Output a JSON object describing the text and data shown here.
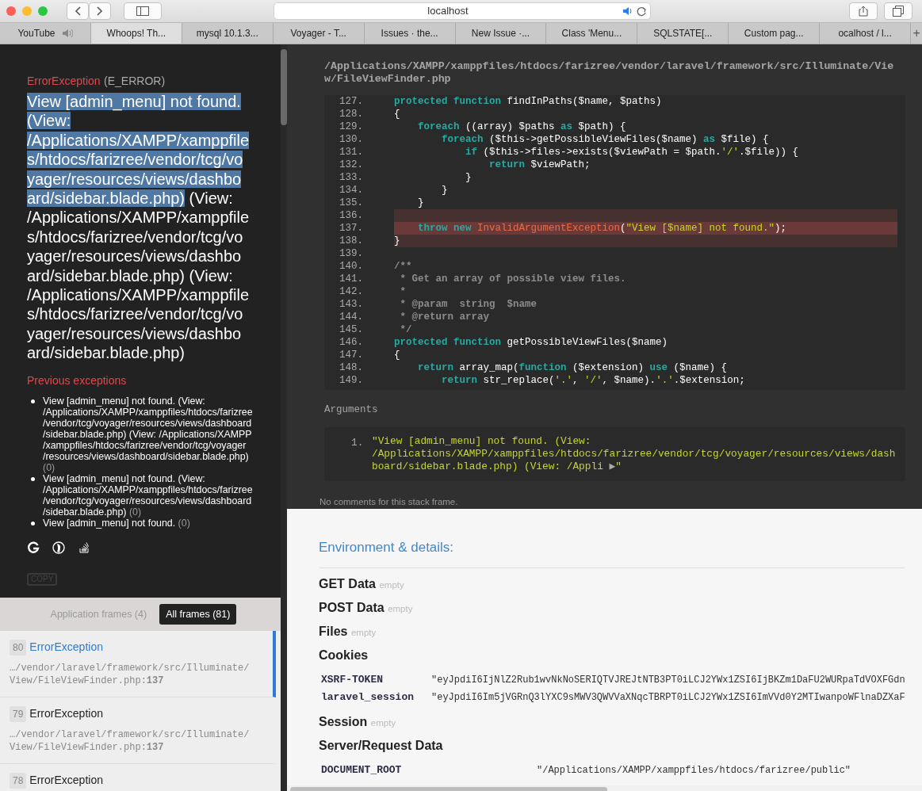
{
  "browser": {
    "url": "localhost",
    "new_tab": "+",
    "tabs": [
      {
        "label": "YouTube",
        "audio": true,
        "selected": false
      },
      {
        "label": "Whoops! Th...",
        "audio": false,
        "selected": true
      },
      {
        "label": "mysql 10.1.3...",
        "audio": false,
        "selected": false
      },
      {
        "label": "Voyager - T...",
        "audio": false,
        "selected": false
      },
      {
        "label": "Issues · the...",
        "audio": false,
        "selected": false
      },
      {
        "label": "New Issue ·...",
        "audio": false,
        "selected": false
      },
      {
        "label": "Class 'Menu...",
        "audio": false,
        "selected": false
      },
      {
        "label": "SQLSTATE[...",
        "audio": false,
        "selected": false
      },
      {
        "label": "Custom pag...",
        "audio": false,
        "selected": false
      },
      {
        "label": "ocalhost / l...",
        "audio": false,
        "selected": false
      }
    ]
  },
  "exception": {
    "type": "ErrorException",
    "code": "(E_ERROR)",
    "message_parts": [
      {
        "text": "View [admin_menu] not found. (View: /Applications/XAMPP/xamppfiles/htdocs/farizree/vendor/tcg/voyager/resources/views/dashboard/sidebar.blade.php)",
        "selected": true
      },
      {
        "text": " (View: /Applications/XAMPP/xamppfiles/htdocs/farizree/vendor/tcg/voyager/resources/views/dashboard/sidebar.blade.php) (View: /Applications/XAMPP/xamppfiles/htdocs/farizree/vendor/tcg/voyager/resources/views/dashboard/sidebar.blade.php)",
        "selected": false
      }
    ],
    "previous_title": "Previous exceptions",
    "previous": [
      {
        "text": "View [admin_menu] not found. (View: /Applications/XAMPP/xamppfiles/htdocs/farizree/vendor/tcg/voyager/resources/views/dashboard/sidebar.blade.php) (View: /Applications/XAMPP/xamppfiles/htdocs/farizree/vendor/tcg/voyager/resources/views/dashboard/sidebar.blade.php)",
        "code": "(0)"
      },
      {
        "text": "View [admin_menu] not found. (View: /Applications/XAMPP/xamppfiles/htdocs/farizree/vendor/tcg/voyager/resources/views/dashboard/sidebar.blade.php)",
        "code": "(0)"
      },
      {
        "text": "View [admin_menu] not found.",
        "code": "(0)"
      }
    ],
    "copy_button": "COPY"
  },
  "frame_tabs": [
    {
      "label": "Application frames (4)",
      "selected": false
    },
    {
      "label": "All frames (81)",
      "selected": true
    }
  ],
  "frames": [
    {
      "number": "80",
      "type": "ErrorException",
      "path": "…/vendor/laravel/framework/src/Illuminate/View/FileViewFinder.php:",
      "line": "137",
      "selected": true
    },
    {
      "number": "79",
      "type": "ErrorException",
      "path": "…/vendor/laravel/framework/src/Illuminate/View/FileViewFinder.php:",
      "line": "137",
      "selected": false
    },
    {
      "number": "78",
      "type": "ErrorException",
      "selected": false
    }
  ],
  "code": {
    "file": "/Applications/XAMPP/xamppfiles/htdocs/farizree/vendor/laravel/framework/src/Illuminate/View/FileViewFinder.php",
    "lines": [
      {
        "number": "127.",
        "highlighted": false,
        "error": false,
        "tokens": [
          {
            "kind": "keyword",
            "text": "protected function"
          },
          {
            "kind": "plain",
            "text": " findInPaths($name, $paths)"
          }
        ]
      },
      {
        "number": "128.",
        "highlighted": false,
        "error": false,
        "tokens": [
          {
            "kind": "plain",
            "text": "{"
          }
        ]
      },
      {
        "number": "129.",
        "highlighted": false,
        "error": false,
        "tokens": [
          {
            "kind": "keyword",
            "text": "    foreach"
          },
          {
            "kind": "plain",
            "text": " ((array) $paths "
          },
          {
            "kind": "keyword",
            "text": "as"
          },
          {
            "kind": "plain",
            "text": " $path) {"
          }
        ]
      },
      {
        "number": "130.",
        "highlighted": false,
        "error": false,
        "tokens": [
          {
            "kind": "keyword",
            "text": "        foreach"
          },
          {
            "kind": "plain",
            "text": " ($this->getPossibleViewFiles($name) "
          },
          {
            "kind": "keyword",
            "text": "as"
          },
          {
            "kind": "plain",
            "text": " $file) {"
          }
        ]
      },
      {
        "number": "131.",
        "highlighted": false,
        "error": false,
        "tokens": [
          {
            "kind": "keyword",
            "text": "            if"
          },
          {
            "kind": "plain",
            "text": " ($this->files->exists($viewPath = $path."
          },
          {
            "kind": "string",
            "text": "'/'"
          },
          {
            "kind": "plain",
            "text": ".$file)) {"
          }
        ]
      },
      {
        "number": "132.",
        "highlighted": false,
        "error": false,
        "tokens": [
          {
            "kind": "keyword",
            "text": "                return"
          },
          {
            "kind": "plain",
            "text": " $viewPath;"
          }
        ]
      },
      {
        "number": "133.",
        "highlighted": false,
        "error": false,
        "tokens": [
          {
            "kind": "plain",
            "text": "            }"
          }
        ]
      },
      {
        "number": "134.",
        "highlighted": false,
        "error": false,
        "tokens": [
          {
            "kind": "plain",
            "text": "        }"
          }
        ]
      },
      {
        "number": "135.",
        "highlighted": false,
        "error": false,
        "tokens": [
          {
            "kind": "plain",
            "text": "    }"
          }
        ]
      },
      {
        "number": "136.",
        "highlighted": true,
        "error": false
      },
      {
        "number": "137.",
        "highlighted": true,
        "error": true,
        "tokens": [
          {
            "kind": "keyword",
            "text": "    throw new "
          },
          {
            "kind": "class",
            "text": "InvalidArgumentException"
          },
          {
            "kind": "plain",
            "text": "("
          },
          {
            "kind": "string",
            "text": "\"View [$name] not found.\""
          },
          {
            "kind": "plain",
            "text": ");"
          }
        ]
      },
      {
        "number": "138.",
        "highlighted": true,
        "error": false,
        "tokens": [
          {
            "kind": "plain",
            "text": "}"
          }
        ]
      },
      {
        "number": "139.",
        "highlighted": false,
        "error": false
      },
      {
        "number": "140.",
        "highlighted": false,
        "error": false,
        "tokens": [
          {
            "kind": "comment",
            "text": "/**"
          }
        ]
      },
      {
        "number": "141.",
        "highlighted": false,
        "error": false,
        "tokens": [
          {
            "kind": "comment",
            "text": " * Get an array of possible view files."
          }
        ]
      },
      {
        "number": "142.",
        "highlighted": false,
        "error": false,
        "tokens": [
          {
            "kind": "comment",
            "text": " *"
          }
        ]
      },
      {
        "number": "143.",
        "highlighted": false,
        "error": false,
        "tokens": [
          {
            "kind": "comment",
            "text": " * @param  string  $name"
          }
        ]
      },
      {
        "number": "144.",
        "highlighted": false,
        "error": false,
        "tokens": [
          {
            "kind": "comment",
            "text": " * @return array"
          }
        ]
      },
      {
        "number": "145.",
        "highlighted": false,
        "error": false,
        "tokens": [
          {
            "kind": "comment",
            "text": " */"
          }
        ]
      },
      {
        "number": "146.",
        "highlighted": false,
        "error": false,
        "tokens": [
          {
            "kind": "keyword",
            "text": "protected function"
          },
          {
            "kind": "plain",
            "text": " getPossibleViewFiles($name)"
          }
        ]
      },
      {
        "number": "147.",
        "highlighted": false,
        "error": false,
        "tokens": [
          {
            "kind": "plain",
            "text": "{"
          }
        ]
      },
      {
        "number": "148.",
        "highlighted": false,
        "error": false,
        "tokens": [
          {
            "kind": "keyword",
            "text": "    return"
          },
          {
            "kind": "plain",
            "text": " array_map("
          },
          {
            "kind": "keyword",
            "text": "function"
          },
          {
            "kind": "plain",
            "text": " ($extension) "
          },
          {
            "kind": "keyword",
            "text": "use"
          },
          {
            "kind": "plain",
            "text": " ($name) {"
          }
        ]
      },
      {
        "number": "149.",
        "highlighted": false,
        "error": false,
        "tokens": [
          {
            "kind": "keyword",
            "text": "        return"
          },
          {
            "kind": "plain",
            "text": " str_replace("
          },
          {
            "kind": "string",
            "text": "'.'"
          },
          {
            "kind": "plain",
            "text": ", "
          },
          {
            "kind": "string",
            "text": "'/'"
          },
          {
            "kind": "plain",
            "text": ", $name)."
          },
          {
            "kind": "string",
            "text": "'.'"
          },
          {
            "kind": "plain",
            "text": ".$extension;"
          }
        ]
      }
    ],
    "arguments_label": "Arguments",
    "arguments": [
      {
        "number": "1.",
        "value": "\"View [admin_menu] not found. (View: /Applications/XAMPP/xamppfiles/htdocs/farizree/vendor/tcg/voyager/resources/views/dashboard/sidebar.blade.php) (View: /Appli",
        "toggle": "▶",
        "end": "\""
      }
    ],
    "comments": "No comments for this stack frame."
  },
  "environment": {
    "title": "Environment & details:",
    "sections": [
      {
        "title": "GET Data",
        "empty": "empty"
      },
      {
        "title": "POST Data",
        "empty": "empty"
      },
      {
        "title": "Files",
        "empty": "empty"
      },
      {
        "title": "Cookies",
        "rows": [
          {
            "key": "XSRF-TOKEN",
            "value": "\"eyJpdiI6IjNlZ2Rub1wvNkNoSERIQTVJREJtNTB3PT0iLCJ2YWx1ZSI6IjBKZm1DaFU2WURpaTdVOXFGdn"
          },
          {
            "key": "laravel_session",
            "value": "\"eyJpdiI6Im5jVGRnQ3lYXC9sMWV3QWVVaXNqcTBRPT0iLCJ2YWx1ZSI6ImVVd0Y2MTIwanpoWFlnaDZXaF"
          }
        ]
      },
      {
        "title": "Session",
        "empty": "empty"
      },
      {
        "title": "Server/Request Data",
        "rows": [
          {
            "key": "DOCUMENT_ROOT",
            "value": "\"/Applications/XAMPP/xamppfiles/htdocs/farizree/public\""
          }
        ]
      }
    ]
  }
}
